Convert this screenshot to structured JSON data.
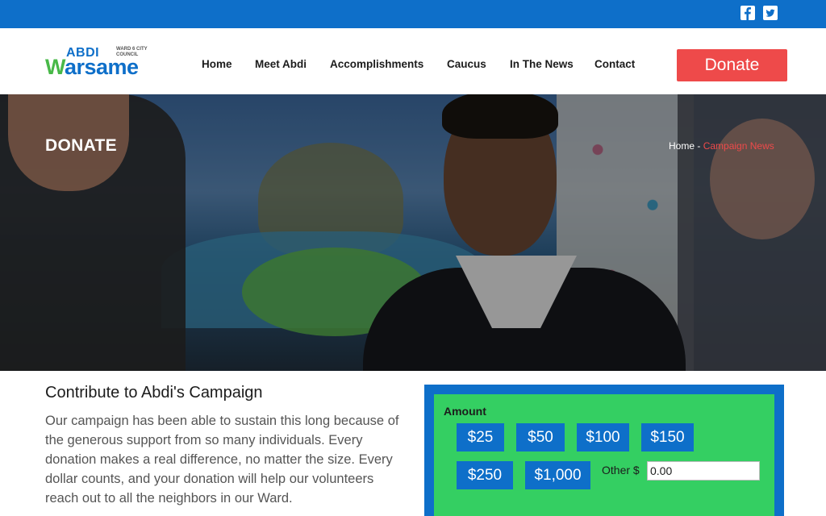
{
  "topbar": {
    "social": [
      {
        "icon": "facebook-icon"
      },
      {
        "icon": "twitter-icon"
      }
    ],
    "color": "#0e6fc9"
  },
  "header": {
    "logo": {
      "top": "ABDI",
      "sub": "WARD 6 CITY COUNCIL",
      "main": "Warsame"
    },
    "nav": [
      "Home",
      "Meet Abdi",
      "Accomplishments",
      "Caucus",
      "In The News",
      "Contact"
    ],
    "donate_label": "Donate",
    "donate_color": "#ee4a4a"
  },
  "hero": {
    "title": "DONATE",
    "breadcrumb": {
      "home": "Home",
      "separator": "-",
      "current": "Campaign News"
    }
  },
  "content": {
    "title": "Contribute to Abdi's Campaign",
    "body": "Our campaign has been able to sustain this long because of the generous support from so many individuals. Every donation makes a real difference, no matter the size. Every dollar counts, and your donation will help our volunteers reach out to all the neighbors in our Ward."
  },
  "donate_form": {
    "amount_label": "Amount",
    "amounts": [
      "$25",
      "$50",
      "$100",
      "$150",
      "$250",
      "$1,000"
    ],
    "other_label": "Other $",
    "other_value": "0.00",
    "box_color": "#0e6fc9",
    "inner_color": "#34cf62"
  }
}
